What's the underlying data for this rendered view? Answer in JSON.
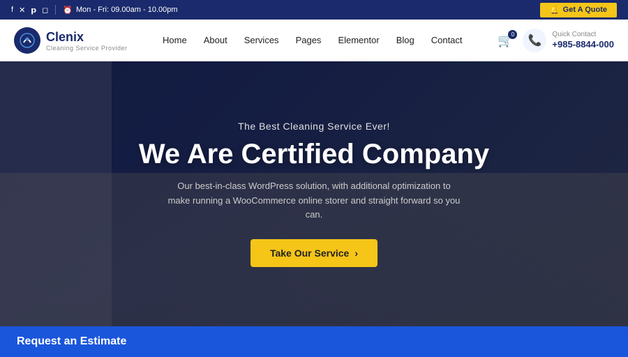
{
  "topbar": {
    "schedule": "Mon - Fri: 09.00am - 10.00pm",
    "quote_btn": "Get A Quote",
    "bell_icon": "🔔",
    "socials": [
      "f",
      "𝕏",
      "𝗣",
      "𝗶"
    ]
  },
  "navbar": {
    "logo_name": "Clenix",
    "logo_sub": "Cleaning Service Provider",
    "logo_icon": "✦",
    "nav_items": [
      {
        "label": "Home",
        "href": "#"
      },
      {
        "label": "About",
        "href": "#"
      },
      {
        "label": "Services",
        "href": "#"
      },
      {
        "label": "Pages",
        "href": "#"
      },
      {
        "label": "Elementor",
        "href": "#"
      },
      {
        "label": "Blog",
        "href": "#"
      },
      {
        "label": "Contact",
        "href": "#"
      }
    ],
    "cart_count": "0",
    "quick_contact_label": "Quick Contact",
    "phone": "+985-8844-000"
  },
  "hero": {
    "subtitle": "The Best Cleaning Service Ever!",
    "title": "We Are Certified Company",
    "description": "Our best-in-class WordPress solution, with additional optimization to make running a WooCommerce online storer and straight forward so you can.",
    "cta_label": "Take Our Service",
    "cta_arrow": "›"
  },
  "cta_strip": {
    "text": "Request an Estimate"
  }
}
